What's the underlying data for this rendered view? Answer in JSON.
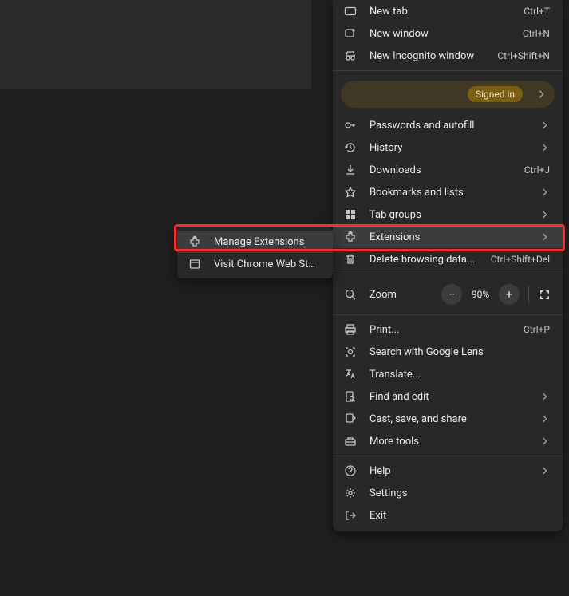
{
  "main_menu": {
    "new_tab": {
      "label": "New tab",
      "shortcut": "Ctrl+T"
    },
    "new_window": {
      "label": "New window",
      "shortcut": "Ctrl+N"
    },
    "incognito": {
      "label": "New Incognito window",
      "shortcut": "Ctrl+Shift+N"
    },
    "signed_in_badge": "Signed in",
    "passwords": {
      "label": "Passwords and autofill"
    },
    "history": {
      "label": "History"
    },
    "downloads": {
      "label": "Downloads",
      "shortcut": "Ctrl+J"
    },
    "bookmarks": {
      "label": "Bookmarks and lists"
    },
    "tab_groups": {
      "label": "Tab groups"
    },
    "extensions": {
      "label": "Extensions"
    },
    "delete_data": {
      "label": "Delete browsing data...",
      "shortcut": "Ctrl+Shift+Del"
    },
    "zoom": {
      "label": "Zoom",
      "value": "90%"
    },
    "print": {
      "label": "Print...",
      "shortcut": "Ctrl+P"
    },
    "lens": {
      "label": "Search with Google Lens"
    },
    "translate": {
      "label": "Translate..."
    },
    "find": {
      "label": "Find and edit"
    },
    "cast": {
      "label": "Cast, save, and share"
    },
    "more_tools": {
      "label": "More tools"
    },
    "help": {
      "label": "Help"
    },
    "settings": {
      "label": "Settings"
    },
    "exit": {
      "label": "Exit"
    }
  },
  "submenu": {
    "manage_extensions": "Manage Extensions",
    "visit_store": "Visit Chrome Web Store"
  }
}
